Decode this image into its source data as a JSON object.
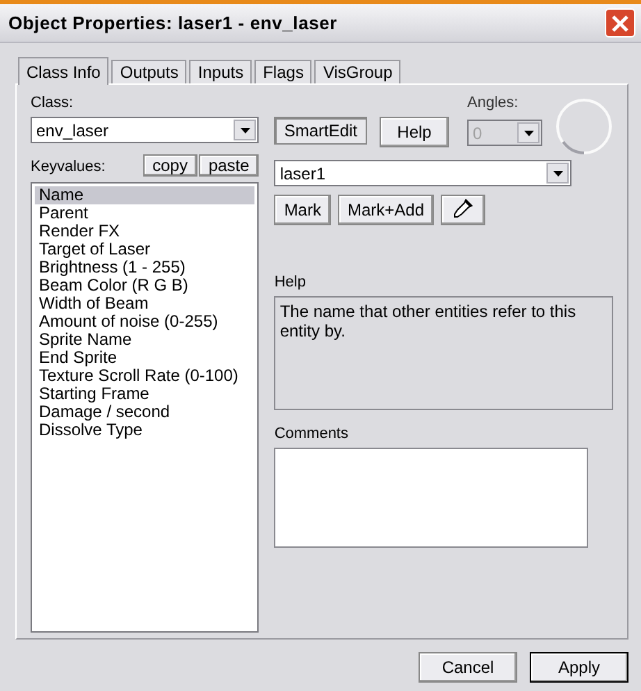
{
  "window": {
    "title": "Object Properties: laser1 - env_laser"
  },
  "tabs": [
    {
      "label": "Class Info",
      "selected": true
    },
    {
      "label": "Outputs",
      "selected": false
    },
    {
      "label": "Inputs",
      "selected": false
    },
    {
      "label": "Flags",
      "selected": false
    },
    {
      "label": "VisGroup",
      "selected": false
    }
  ],
  "class_field": {
    "label": "Class:",
    "value": "env_laser"
  },
  "smart_edit": {
    "label": "SmartEdit",
    "on": true
  },
  "help_button": "Help",
  "angles": {
    "label": "Angles:",
    "value": "0",
    "disabled": true
  },
  "keyvalues": {
    "label": "Keyvalues:",
    "buttons": [
      "copy",
      "paste"
    ],
    "items": [
      {
        "label": "Name",
        "selected": true
      },
      {
        "label": "Parent",
        "selected": false
      },
      {
        "label": "Render FX",
        "selected": false
      },
      {
        "label": "Target of Laser",
        "selected": false
      },
      {
        "label": "Brightness (1 - 255)",
        "selected": false
      },
      {
        "label": "Beam Color (R G B)",
        "selected": false
      },
      {
        "label": "Width of Beam",
        "selected": false
      },
      {
        "label": "Amount of noise (0-255)",
        "selected": false
      },
      {
        "label": "Sprite Name",
        "selected": false
      },
      {
        "label": "End Sprite",
        "selected": false
      },
      {
        "label": "Texture Scroll Rate (0-100)",
        "selected": false
      },
      {
        "label": "Starting Frame",
        "selected": false
      },
      {
        "label": "Damage / second",
        "selected": false
      },
      {
        "label": "Dissolve Type",
        "selected": false
      }
    ]
  },
  "value_field": {
    "value": "laser1"
  },
  "mark_buttons": [
    "Mark",
    "Mark+Add"
  ],
  "help": {
    "label": "Help",
    "text": "The name that other entities refer to this entity by."
  },
  "comments": {
    "label": "Comments"
  },
  "footer_buttons": [
    {
      "label": "Cancel",
      "default": false
    },
    {
      "label": "Apply",
      "default": true
    }
  ]
}
